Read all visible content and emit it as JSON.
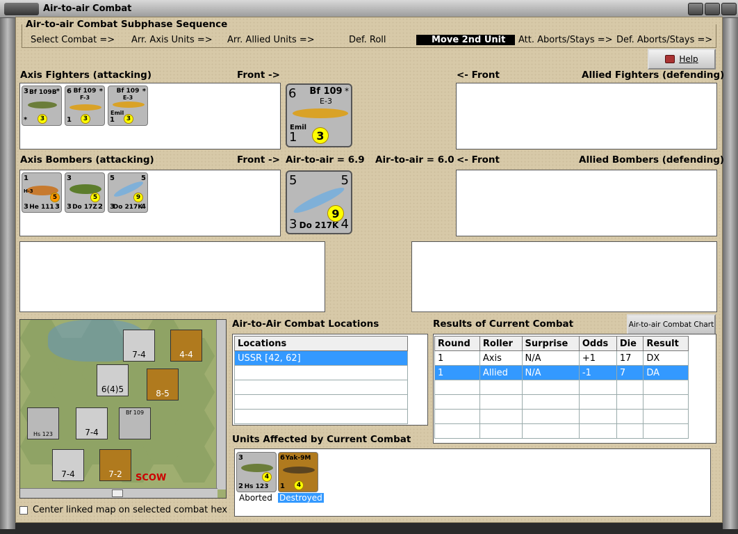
{
  "window": {
    "title": "Air-to-air Combat"
  },
  "sequence": {
    "title": "Air-to-air Combat Subphase Sequence",
    "steps": [
      "Select Combat =>",
      "Arr. Axis Units =>",
      "Arr. Allied Units =>",
      "Def. Roll",
      "Move 2nd Unit",
      "Att. Aborts/Stays =>",
      "Def. Aborts/Stays =>"
    ],
    "active_index": 4
  },
  "help": {
    "label": "Help"
  },
  "axis_fighters": {
    "title": "Axis Fighters (attacking)",
    "front": "Front ->",
    "units": [
      {
        "top_left": "3",
        "name": "Bf 109B",
        "star": "*",
        "bottom": "*",
        "rating": "3"
      },
      {
        "top_left": "6",
        "name": "Bf 109",
        "sub": "F-3",
        "star": "*",
        "bottom": "1",
        "rating": "3"
      },
      {
        "top_left": "",
        "name": "Bf 109",
        "sub": "E-3",
        "extra": "Emil",
        "star": "*",
        "bottom": "1",
        "rating": "3"
      }
    ]
  },
  "selected_fighter": {
    "top_left": "6",
    "name": "Bf 109",
    "sub": "E-3",
    "extra": "Emil",
    "bottom_left": "1",
    "rating": "3",
    "star": "*"
  },
  "allied_fighters": {
    "title": "Allied Fighters (defending)",
    "front": "<- Front"
  },
  "axis_bombers": {
    "title": "Axis Bombers (attacking)",
    "front": "Front ->",
    "air_to_air": "Air-to-air = 6.9",
    "units": [
      {
        "top_left": "1",
        "name": "He 111",
        "sub": "H-3",
        "rating": "5",
        "bl": "3",
        "br": "3"
      },
      {
        "top_left": "3",
        "name": "Do 17Z",
        "rating": "5",
        "bl": "3",
        "br": "2"
      },
      {
        "top_left": "5",
        "name": "Do 217K",
        "rating": "9",
        "bl": "3",
        "br": "4",
        "tr": "5"
      }
    ]
  },
  "selected_bomber": {
    "tl": "5",
    "tr": "5",
    "name": "Do 217K",
    "rating": "9",
    "bl": "3",
    "br": "4"
  },
  "allied_bombers": {
    "title": "Allied Bombers (defending)",
    "front": "<- Front",
    "air_to_air": "Air-to-air = 6.0"
  },
  "locations": {
    "title": "Air-to-Air Combat Locations",
    "header": "Locations",
    "items": [
      "USSR [42, 62]"
    ]
  },
  "results": {
    "title": "Results of Current Combat",
    "chart_button": "Air-to-air Combat Chart",
    "headers": [
      "Round",
      "Roller",
      "Surprise",
      "Odds",
      "Die",
      "Result"
    ],
    "rows": [
      [
        "1",
        "Axis",
        "N/A",
        "+1",
        "17",
        "DX"
      ],
      [
        "1",
        "Allied",
        "N/A",
        "-1",
        "7",
        "DA"
      ]
    ],
    "selected_row": 1
  },
  "affected": {
    "title": "Units Affected by Current Combat",
    "units": [
      {
        "name": "Hs 123",
        "tl": "3",
        "bl": "2",
        "rating": "4",
        "status": "Aborted"
      },
      {
        "name": "Yak-9M",
        "tl": "6",
        "bl": "1",
        "rating": "4",
        "status": "Destroyed"
      }
    ]
  },
  "map": {
    "units": [
      "7-4",
      "4-4",
      "6(4)5",
      "8-5",
      "7-4",
      "7-4",
      "7-2"
    ],
    "labels": [
      "Hs 123",
      "Bf 109",
      "OS",
      "SCOW",
      "10"
    ],
    "hex_ratings": [
      "3",
      "4",
      "3",
      "2",
      "3",
      "4",
      "3",
      "10",
      "4"
    ]
  },
  "center_checkbox": {
    "label": "Center linked map on selected combat hex",
    "checked": false
  }
}
